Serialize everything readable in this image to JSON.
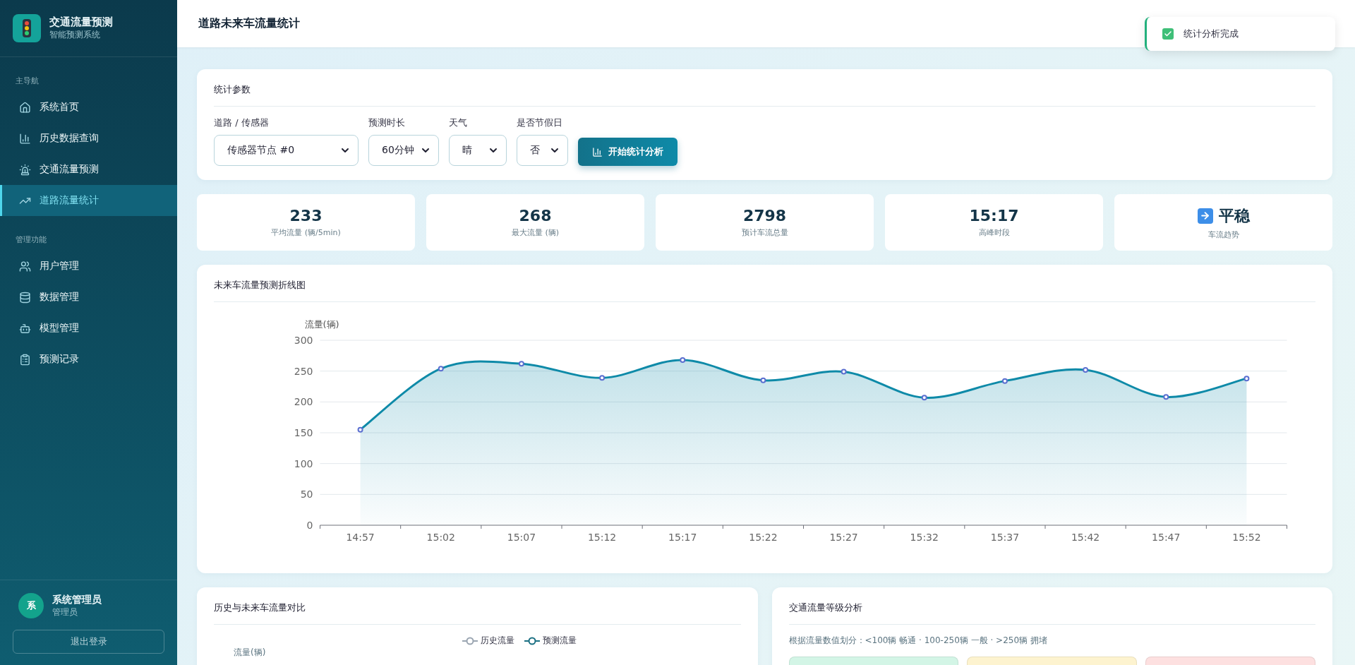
{
  "sidebar": {
    "app_title": "交通流量预测",
    "app_subtitle": "智能预测系统",
    "sections": [
      {
        "title": "主导航",
        "items": [
          {
            "label": "系统首页",
            "selected": false
          },
          {
            "label": "历史数据查询",
            "selected": false
          },
          {
            "label": "交通流量预测",
            "selected": false
          },
          {
            "label": "道路流量统计",
            "selected": true
          }
        ]
      },
      {
        "title": "管理功能",
        "items": [
          {
            "label": "用户管理",
            "selected": false
          },
          {
            "label": "数据管理",
            "selected": false
          },
          {
            "label": "模型管理",
            "selected": false
          },
          {
            "label": "预测记录",
            "selected": false
          }
        ]
      }
    ],
    "user": {
      "avatar": "系",
      "name": "系统管理员",
      "role": "管理员"
    },
    "logout": "退出登录"
  },
  "header": {
    "title": "道路未来车流量统计"
  },
  "toast": {
    "message": "统计分析完成"
  },
  "params": {
    "title": "统计参数",
    "fields": [
      {
        "label": "道路 / 传感器",
        "value": "传感器节点 #0"
      },
      {
        "label": "预测时长",
        "value": "60分钟"
      },
      {
        "label": "天气",
        "value": "晴"
      },
      {
        "label": "是否节假日",
        "value": "否"
      }
    ],
    "button": "开始统计分析"
  },
  "stats": [
    {
      "kind": "number",
      "value": "233",
      "label": "平均流量 (辆/5min)"
    },
    {
      "kind": "number",
      "value": "268",
      "label": "最大流量 (辆)"
    },
    {
      "kind": "number",
      "value": "2798",
      "label": "预计车流总量"
    },
    {
      "kind": "number",
      "value": "15:17",
      "label": "高峰时段"
    },
    {
      "kind": "trend",
      "value": "平稳",
      "label": "车流趋势"
    }
  ],
  "forecast": {
    "title": "未来车流量预测折线图",
    "chart_data": {
      "type": "area",
      "ylabel": "流量(辆)",
      "categories": [
        "14:57",
        "15:02",
        "15:07",
        "15:12",
        "15:17",
        "15:22",
        "15:27",
        "15:32",
        "15:37",
        "15:42",
        "15:47",
        "15:52"
      ],
      "series": [
        {
          "color": "#0e8aa8",
          "values": [
            155,
            254,
            262,
            239,
            268,
            235,
            249,
            207,
            234,
            252,
            208,
            238
          ]
        }
      ],
      "ylim": [
        0,
        300
      ],
      "grid": true,
      "yticks": [
        0,
        50,
        100,
        150,
        200,
        250,
        300
      ]
    }
  },
  "comparison": {
    "title": "历史与未来车流量对比",
    "ylabel": "流量(辆)",
    "legend": [
      {
        "label": "历史流量",
        "color": "#9aa5b1"
      },
      {
        "label": "预测流量",
        "color": "#1a6f82"
      }
    ]
  },
  "levels": {
    "title": "交通流量等级分析",
    "note": "根据流量数值划分：<100辆 畅通 · 100-250辆 一般 · >250辆 拥堵",
    "cards": [
      {
        "color": "#d3f5e6"
      },
      {
        "color": "#fdf3cf"
      },
      {
        "color": "#fde0e0"
      }
    ]
  }
}
